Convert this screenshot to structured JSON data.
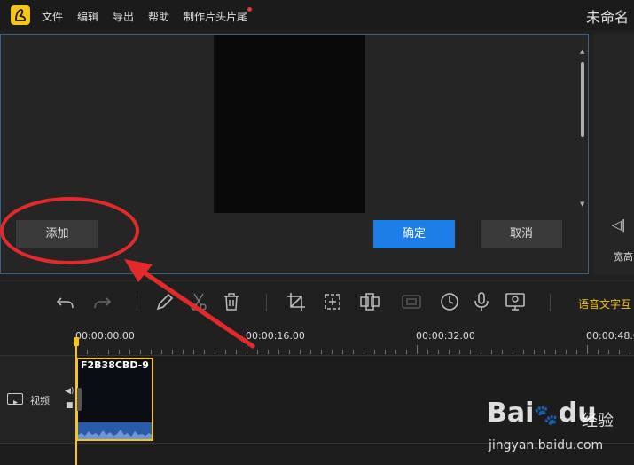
{
  "menubar": {
    "items": [
      "文件",
      "编辑",
      "导出",
      "帮助",
      "制作片头片尾"
    ],
    "title": "未命名"
  },
  "dialog": {
    "add_label": "添加",
    "confirm_label": "确定",
    "cancel_label": "取消"
  },
  "right_panel": {
    "ratio_label": "宽高"
  },
  "toolbar": {
    "tools": [
      "undo-icon",
      "redo-icon",
      "edit-icon",
      "scissors-icon",
      "delete-icon",
      "crop-icon",
      "mosaic-icon",
      "split-screen-icon",
      "freeze-frame-icon",
      "speed-icon",
      "record-audio-icon",
      "record-screen-icon"
    ],
    "speech_label": "语音文字互"
  },
  "timeline": {
    "ticks": [
      "00:00:00.00",
      "00:00:16.00",
      "00:00:32.00",
      "00:00:48.00"
    ],
    "track_label": "视频",
    "clip_name": "F2B38CBD-9"
  },
  "watermark": {
    "logo": "Bai",
    "logo2": "du",
    "cn": "经验",
    "url": "jingyan.baidu.com"
  },
  "colors": {
    "accent": "#f5c518",
    "primary_button": "#1e7ee8",
    "annotation": "#e32a2a"
  }
}
